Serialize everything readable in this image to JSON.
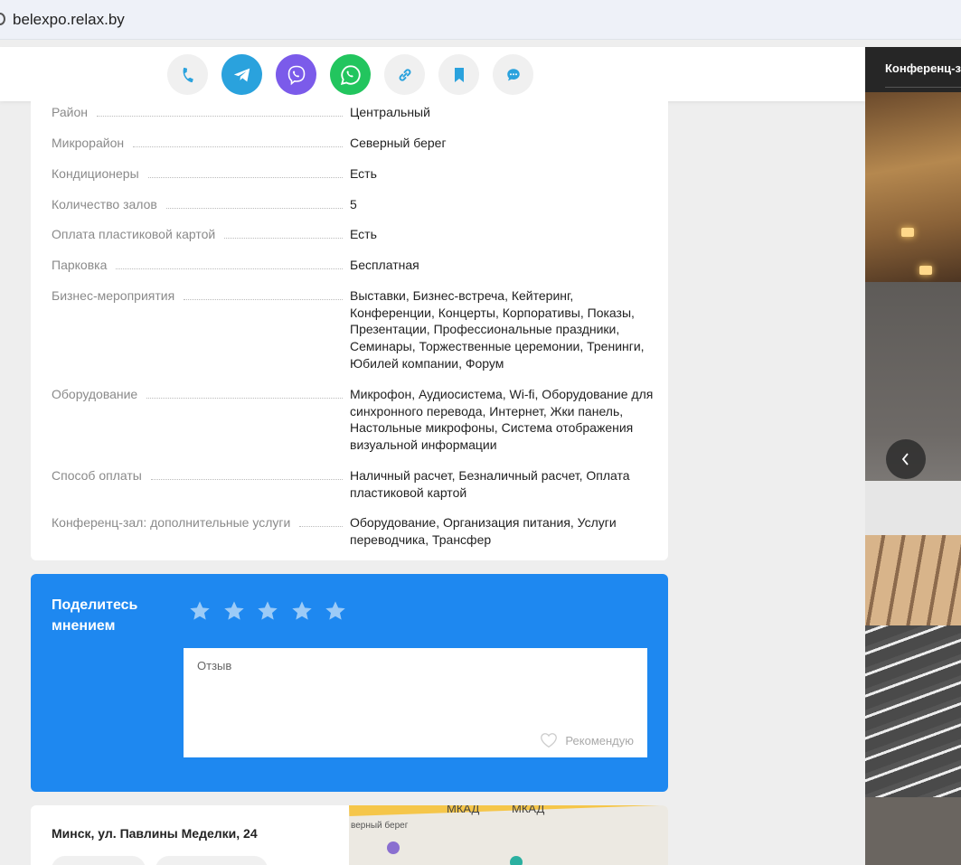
{
  "browser": {
    "url": "belexpo.relax.by"
  },
  "share": {
    "buttons": [
      {
        "name": "phone-icon",
        "color": "#2aa2dd"
      },
      {
        "name": "telegram-icon",
        "color": "#2aa2dd"
      },
      {
        "name": "viber-icon",
        "color": "#7b5bea"
      },
      {
        "name": "whatsapp-icon",
        "color": "#22c55e"
      },
      {
        "name": "link-icon",
        "color": "#2aa2dd"
      },
      {
        "name": "bookmark-icon",
        "color": "#2aa2dd"
      },
      {
        "name": "chat-icon",
        "color": "#2aa2dd"
      }
    ]
  },
  "details": [
    {
      "label": "Район",
      "value": "Центральный"
    },
    {
      "label": "Микрорайон",
      "value": "Северный берег"
    },
    {
      "label": "Кондиционеры",
      "value": "Есть"
    },
    {
      "label": "Количество залов",
      "value": "5"
    },
    {
      "label": "Оплата пластиковой картой",
      "value": "Есть"
    },
    {
      "label": "Парковка",
      "value": "Бесплатная"
    },
    {
      "label": "Бизнес-мероприятия",
      "value": "Выставки, Бизнес-встреча, Кейтеринг, Конференции, Концерты, Корпоративы, Показы, Презентации, Профессиональные праздники, Семинары, Торжественные церемонии, Тренинги, Юбилей компании, Форум"
    },
    {
      "label": "Оборудование",
      "value": "Микрофон, Аудиосистема, Wi-fi, Оборудование для синхронного перевода, Интернет, Жки панель, Настольные микрофоны, Система отображения визуальной информации"
    },
    {
      "label": "Способ оплаты",
      "value": "Наличный расчет, Безналичный расчет, Оплата пластиковой картой"
    },
    {
      "label": "Конференц-зал: дополнительные услуги",
      "value": "Оборудование, Организация питания, Услуги переводчика, Трансфер"
    }
  ],
  "review": {
    "title": "Поделитесь мнением",
    "rating_max": 5,
    "rating_value": 0,
    "placeholder": "Отзыв",
    "recommend_label": "Рекомендую",
    "accent_color": "#1e88f0"
  },
  "location": {
    "address": "Минск, ул. Павлины Меделки, 24",
    "map": {
      "road_labels": [
        "МКАД",
        "МКАД"
      ],
      "district_label": "верный берег"
    }
  },
  "gallery": {
    "title": "Конференц-з"
  }
}
